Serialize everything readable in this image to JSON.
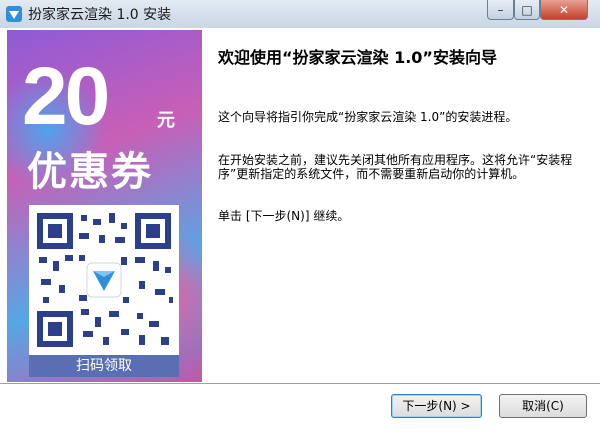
{
  "window": {
    "title": "扮家家云渲染 1.0 安装"
  },
  "controls": {
    "minimize": "–",
    "maximize": "□",
    "close": "✕"
  },
  "banner": {
    "amount": "20",
    "unit": "元",
    "coupon": "优惠券",
    "caption": "扫码领取"
  },
  "wizard": {
    "heading": "欢迎使用“扮家家云渲染 1.0”安装向导",
    "paragraph1": "这个向导将指引你完成“扮家家云渲染 1.0”的安装进程。",
    "paragraph2": "在开始安装之前，建议先关闭其他所有应用程序。这将允许“安装程序”更新指定的系统文件，而不需要重新启动你的计算机。",
    "paragraph3": "单击 [下一步(N)] 继续。"
  },
  "buttons": {
    "next": "下一步(N) >",
    "cancel": "取消(C)"
  }
}
